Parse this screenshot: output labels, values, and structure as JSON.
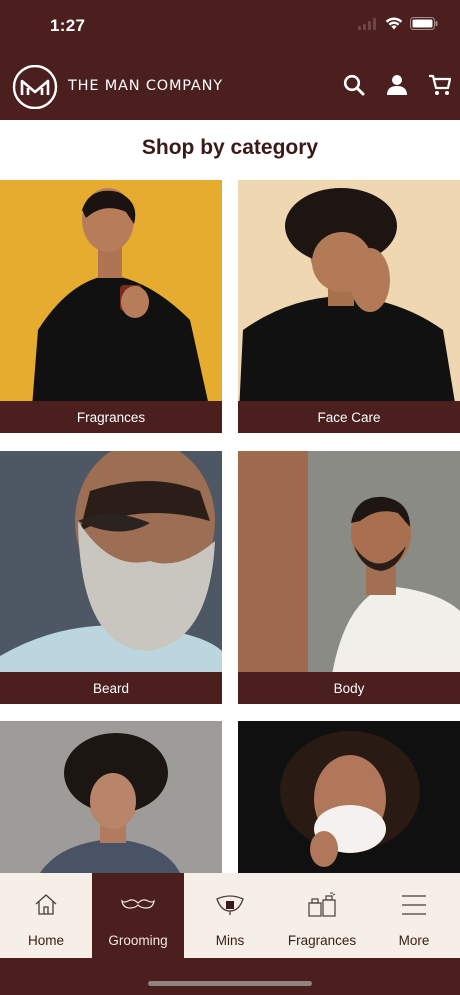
{
  "status": {
    "time": "1:27"
  },
  "header": {
    "brand": "THE MAN COMPANY"
  },
  "section": {
    "title": "Shop by category"
  },
  "categories": [
    {
      "label": "Fragrances"
    },
    {
      "label": "Face Care"
    },
    {
      "label": "Beard"
    },
    {
      "label": "Body"
    },
    {
      "label": ""
    },
    {
      "label": ""
    }
  ],
  "tabs": [
    {
      "label": "Home",
      "icon": "home-icon"
    },
    {
      "label": "Grooming",
      "icon": "mustache-icon"
    },
    {
      "label": "Mins",
      "icon": "mins-icon"
    },
    {
      "label": "Fragrances",
      "icon": "perfume-icon"
    },
    {
      "label": "More",
      "icon": "menu-icon"
    }
  ],
  "active_tab": "Grooming",
  "colors": {
    "brand_maroon": "#4a1f1e",
    "tab_bg": "#f6efe7",
    "text_dark": "#3a1a19"
  }
}
